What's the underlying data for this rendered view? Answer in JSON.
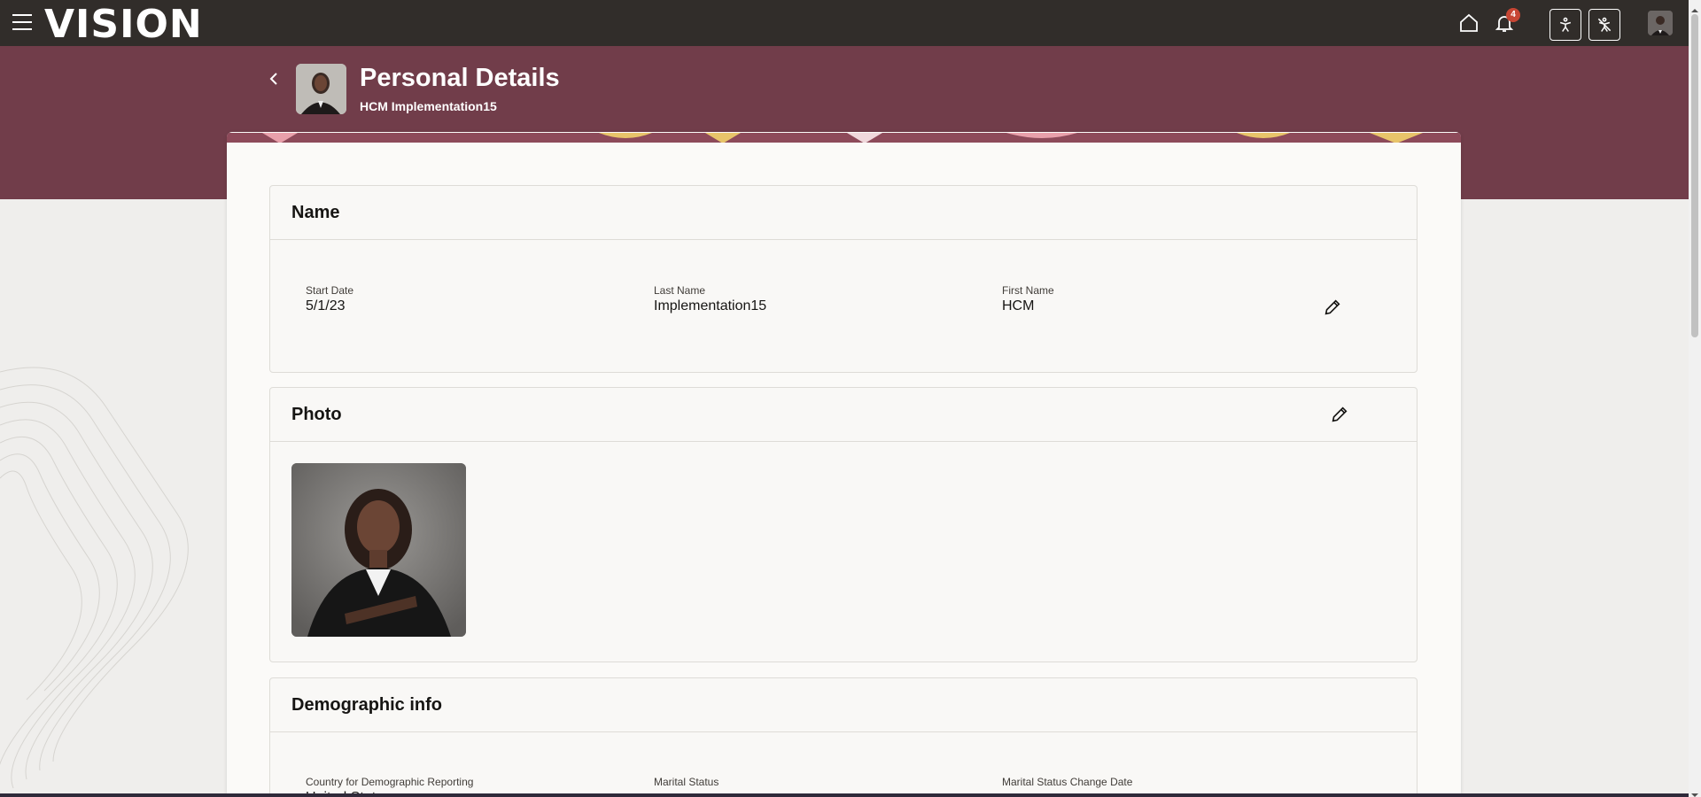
{
  "topbar": {
    "brand": "VISION",
    "notification_count": "4",
    "icons": [
      "menu-icon",
      "home-icon",
      "bell-icon",
      "accessibility-icon",
      "accessibility-off-icon",
      "user-avatar"
    ]
  },
  "header": {
    "title": "Personal Details",
    "subtitle": "HCM Implementation15"
  },
  "sections": {
    "name": {
      "title": "Name",
      "fields": [
        {
          "label": "Start Date",
          "value": "5/1/23"
        },
        {
          "label": "Last Name",
          "value": "Implementation15"
        },
        {
          "label": "First Name",
          "value": "HCM"
        }
      ]
    },
    "photo": {
      "title": "Photo"
    },
    "demographic": {
      "title": "Demographic info",
      "fields": [
        {
          "label": "Country for Demographic Reporting",
          "value": "United States"
        },
        {
          "label": "Marital Status",
          "value": ""
        },
        {
          "label": "Marital Status Change Date",
          "value": ""
        }
      ]
    }
  },
  "colors": {
    "topbar": "#312d2a",
    "header_band": "#713d4a",
    "badge": "#c74634",
    "page_bg": "#efeeec",
    "card_bg": "#fbfaf8"
  }
}
